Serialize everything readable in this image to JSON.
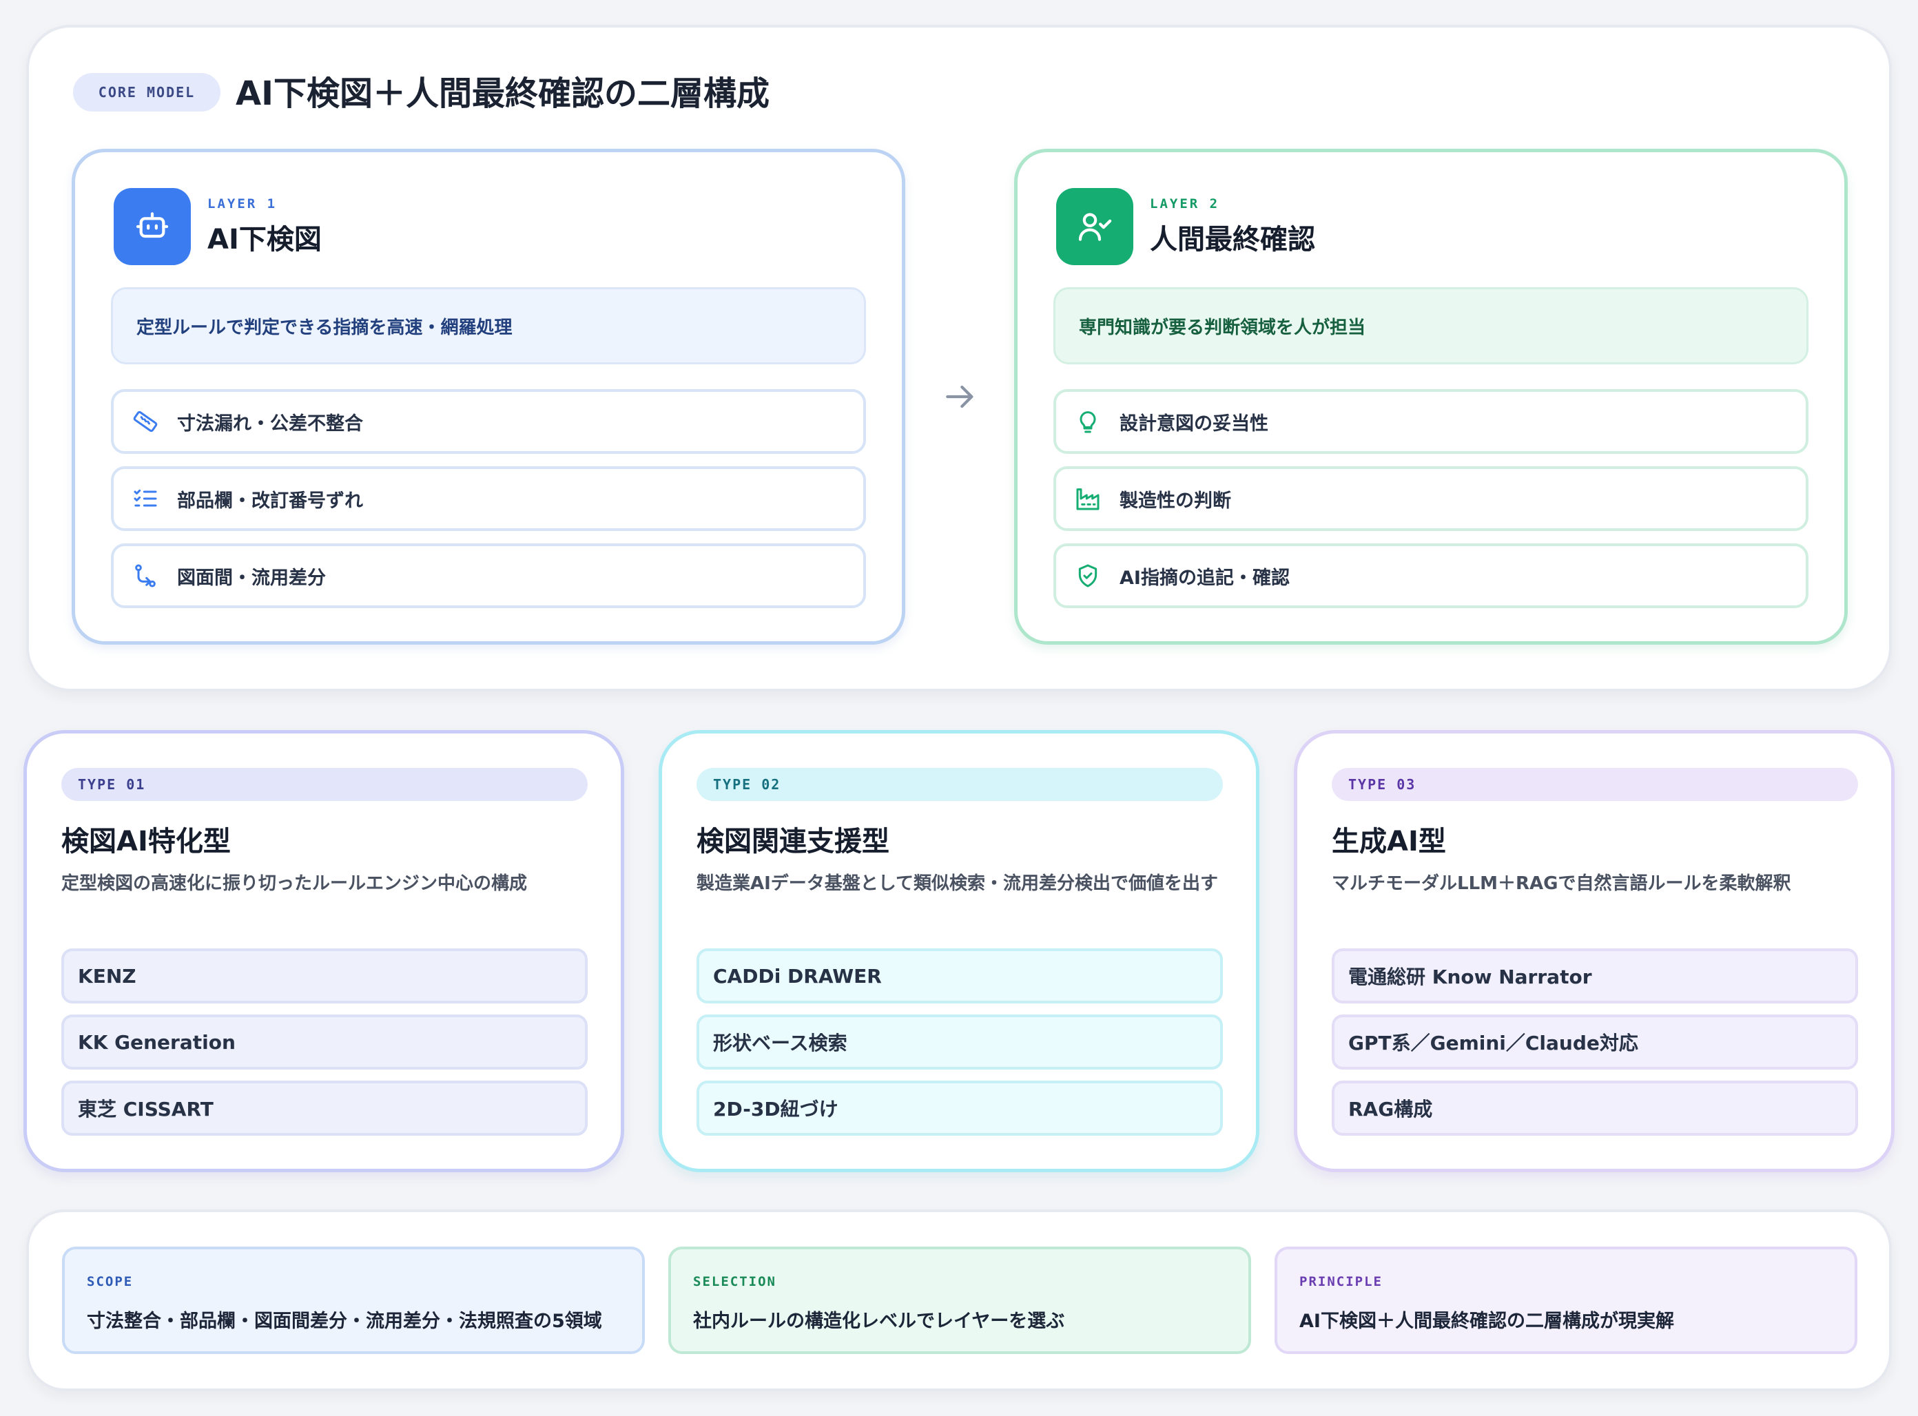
{
  "core": {
    "pill": "CORE MODEL",
    "title": "AI下検図＋人間最終確認の二層構成"
  },
  "layers": [
    {
      "tag": "LAYER 1",
      "name": "AI下検図",
      "icon": "robot-icon",
      "accent": "#3b7df0",
      "desc": "定型ルールで判定できる指摘を高速・網羅処理",
      "items": [
        {
          "icon": "ruler-icon",
          "label": "寸法漏れ・公差不整合"
        },
        {
          "icon": "checklist-icon",
          "label": "部品欄・改訂番号ずれ"
        },
        {
          "icon": "route-icon",
          "label": "図面間・流用差分"
        }
      ]
    },
    {
      "tag": "LAYER 2",
      "name": "人間最終確認",
      "icon": "user-check-icon",
      "accent": "#16ad73",
      "desc": "専門知識が要る判断領域を人が担当",
      "items": [
        {
          "icon": "lightbulb-icon",
          "label": "設計意図の妥当性"
        },
        {
          "icon": "factory-icon",
          "label": "製造性の判断"
        },
        {
          "icon": "shield-check-icon",
          "label": "AI指摘の追記・確認"
        }
      ]
    }
  ],
  "types": [
    {
      "tag": "TYPE 01",
      "title": "検図AI特化型",
      "desc": "定型検図の高速化に振り切ったルールエンジン中心の構成",
      "items": [
        "KENZ",
        "KK Generation",
        "東芝 CISSART"
      ]
    },
    {
      "tag": "TYPE 02",
      "title": "検図関連支援型",
      "desc": "製造業AIデータ基盤として類似検索・流用差分検出で価値を出す",
      "items": [
        "CADDi DRAWER",
        "形状ベース検索",
        "2D-3D紐づけ"
      ]
    },
    {
      "tag": "TYPE 03",
      "title": "生成AI型",
      "desc": "マルチモーダルLLM＋RAGで自然言語ルールを柔軟解釈",
      "items": [
        "電通総研 Know Narrator",
        "GPT系／Gemini／Claude対応",
        "RAG構成"
      ]
    }
  ],
  "summary": [
    {
      "label": "SCOPE",
      "text": "寸法整合・部品欄・図面間差分・流用差分・法規照査の5領域"
    },
    {
      "label": "SELECTION",
      "text": "社内ルールの構造化レベルでレイヤーを選ぶ"
    },
    {
      "label": "PRINCIPLE",
      "text": "AI下検図＋人間最終確認の二層構成が現実解"
    }
  ]
}
